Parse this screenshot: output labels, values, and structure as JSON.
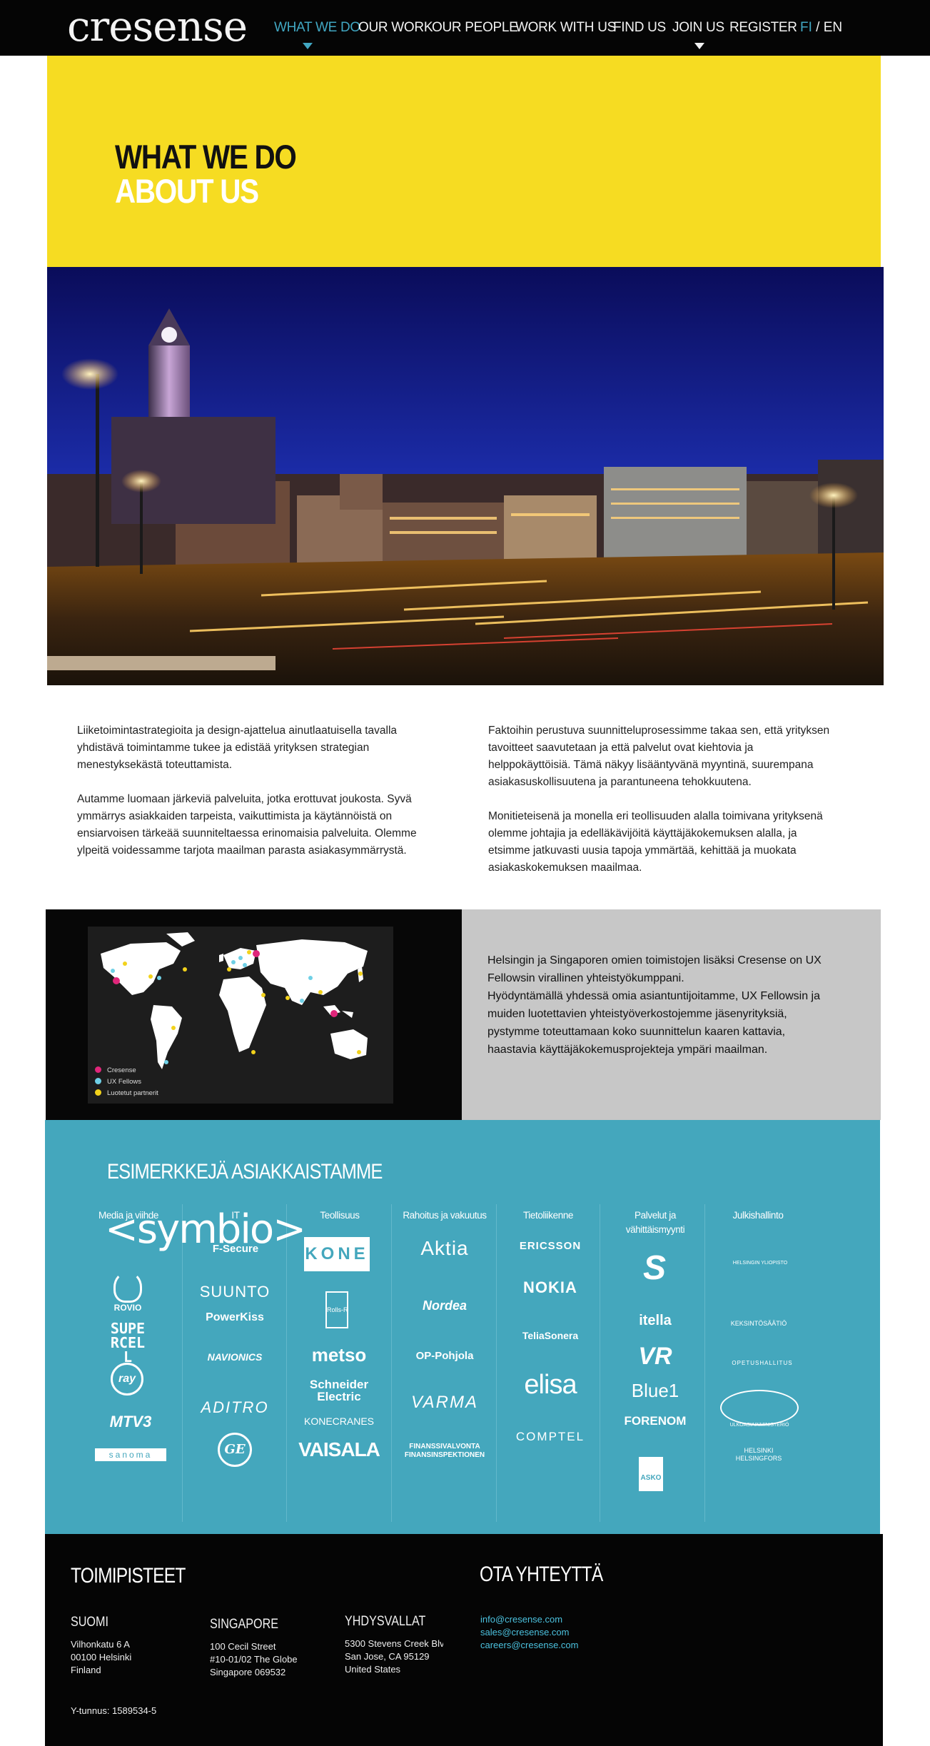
{
  "brand": {
    "logo_text": "cresense"
  },
  "nav": {
    "items": [
      {
        "label": "WHAT WE DO",
        "active": true,
        "has_caret": true
      },
      {
        "label": "OUR WORK",
        "active": false,
        "has_caret": false
      },
      {
        "label": "OUR PEOPLE",
        "active": false,
        "has_caret": false
      },
      {
        "label": "WORK WITH US",
        "active": false,
        "has_caret": false
      },
      {
        "label": "FIND US",
        "active": false,
        "has_caret": false
      },
      {
        "label": "JOIN US",
        "active": false,
        "has_caret": true
      },
      {
        "label": "REGISTER",
        "active": false,
        "has_caret": false
      }
    ],
    "lang_fi": "FI",
    "lang_sep": "/",
    "lang_en": "EN"
  },
  "hero": {
    "title": "WHAT WE DO",
    "subtitle": "ABOUT US",
    "background": "#f6dc22"
  },
  "intro": {
    "left": [
      "Liiketoimintastrategioita ja design-ajattelua ainutlaatuisella tavalla yhdistävä toimintamme tukee ja edistää yrityksen strategian menestyksekästä toteuttamista.",
      "Autamme luomaan järkeviä palveluita, jotka erottuvat joukosta. Syvä ymmärrys asiakkaiden tarpeista, vaikuttimista ja käytännöistä on ensiarvoisen tärkeää suunniteltaessa erinomaisia palveluita. Olemme ylpeitä voidessamme tarjota maailman parasta asiakasymmärrystä."
    ],
    "right": [
      "Faktoihin perustuva suunnitteluprosessimme takaa sen, että yrityksen tavoitteet saavutetaan ja että palvelut ovat kiehtovia ja helppokäyttöisiä. Tämä näkyy lisääntyvänä myyntinä, suurempana asiakasuskollisuutena ja parantuneena tehokkuutena.",
      "Monitieteisenä ja monella eri teollisuuden alalla toimivana yrityksenä olemme johtajia ja edelläkävijöitä käyttäjäkokemuksen alalla, ja etsimme jatkuvasti uusia tapoja ymmärtää, kehittää ja muokata asiakaskokemuksen maailmaa."
    ]
  },
  "map": {
    "legend": [
      {
        "label": "Cresense",
        "color": "#e0267a"
      },
      {
        "label": "UX Fellows",
        "color": "#6fd0e6"
      },
      {
        "label": "Luotetut partnerit",
        "color": "#f2d21b"
      }
    ],
    "text_lines": [
      "Helsingin ja Singaporen omien toimistojen lisäksi Cresense on UX Fellowsin virallinen yhteistyökumppani.",
      "Hyödyntämällä yhdessä omia asiantuntijoitamme, UX Fellowsin ja muiden luotettavien yhteistyöverkostojemme jäsenyrityksiä, pystymme toteuttamaan koko suunnittelun kaaren kattavia, haastavia käyttäjäkokemusprojekteja ympäri maailman."
    ]
  },
  "clients": {
    "title": "ESIMERKKEJÄ ASIAKKAISTAMME",
    "overlay_logo": "<symbio>",
    "columns": [
      {
        "category": "Media ja viihde",
        "logos": [
          "ROVIO",
          "SUPERCELL",
          "ray",
          "MTV3",
          "sanoma"
        ]
      },
      {
        "category": "IT",
        "logos": [
          "F-Secure",
          "SUUNTO",
          "PowerKiss",
          "NAVIONICS",
          "ADITRO",
          "GE"
        ]
      },
      {
        "category": "Teollisuus",
        "logos": [
          "KONE",
          "Rolls-Royce",
          "metso",
          "Schneider Electric",
          "KONECRANES",
          "VAISALA"
        ]
      },
      {
        "category": "Rahoitus ja vakuutus",
        "logos": [
          "Aktia",
          "Nordea",
          "OP-Pohjola",
          "VARMA",
          "FINANSSIVALVONTA FINANSINSPEKTIONEN"
        ]
      },
      {
        "category": "Tietoliikenne",
        "logos": [
          "ERICSSON",
          "NOKIA",
          "TeliaSonera",
          "elisa",
          "COMPTEL"
        ]
      },
      {
        "category": "Palvelut ja vähittäismyynti",
        "logos": [
          "S",
          "itella",
          "VR",
          "Blue1",
          "FORENOM",
          "ASKO"
        ]
      },
      {
        "category": "Julkishallinto",
        "logos": [
          "HELSINGIN YLIOPISTO",
          "KEKSINTÖSÄÄTIÖ",
          "OPETUSHALLITUS",
          "ULKOASIAINMINISTERIÖ",
          "HELSINKI HELSINGFORS"
        ]
      }
    ]
  },
  "footer": {
    "offices_title": "TOIMIPISTEET",
    "contact_title": "OTA YHTEYTTÄ",
    "offices": [
      {
        "country": "SUOMI",
        "lines": [
          "Vilhonkatu 6 A",
          "00100 Helsinki",
          "Finland"
        ]
      },
      {
        "country": "SINGAPORE",
        "lines": [
          "100 Cecil Street",
          "#10-01/02 The Globe",
          "Singapore 069532"
        ]
      },
      {
        "country": "YHDYSVALLAT",
        "lines": [
          "5300 Stevens Creek Blv",
          "San Jose, CA 95129",
          "United States"
        ]
      }
    ],
    "emails": [
      "info@cresense.com",
      "sales@cresense.com",
      "careers@cresense.com"
    ],
    "ytunnus": "Y-tunnus: 1589534-5"
  }
}
